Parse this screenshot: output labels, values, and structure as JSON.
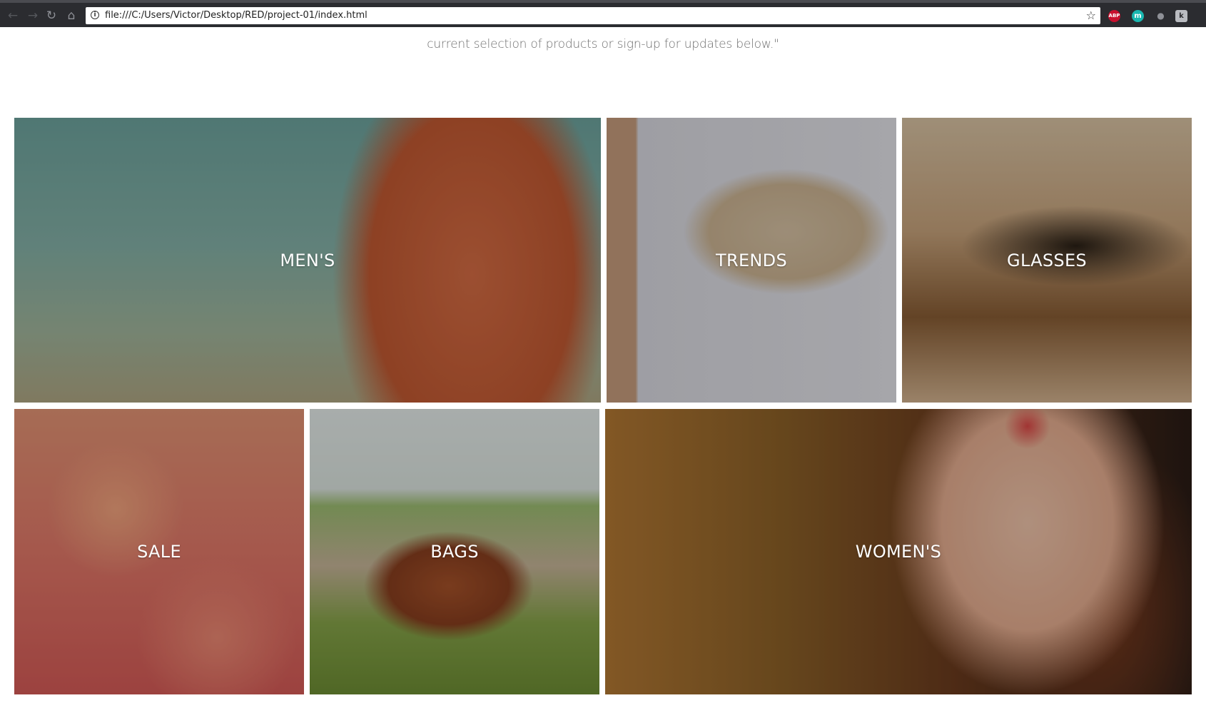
{
  "browser": {
    "url": "file:///C:/Users/Victor/Desktop/RED/project-01/index.html",
    "extensions": [
      "ABP",
      "m",
      "",
      "k"
    ]
  },
  "intro": {
    "text": "current selection of products or sign-up for updates below.\""
  },
  "categories": [
    {
      "label": "MEN'S"
    },
    {
      "label": "TRENDS"
    },
    {
      "label": "GLASSES"
    },
    {
      "label": "SALE"
    },
    {
      "label": "BAGS"
    },
    {
      "label": "WOMEN'S"
    }
  ]
}
